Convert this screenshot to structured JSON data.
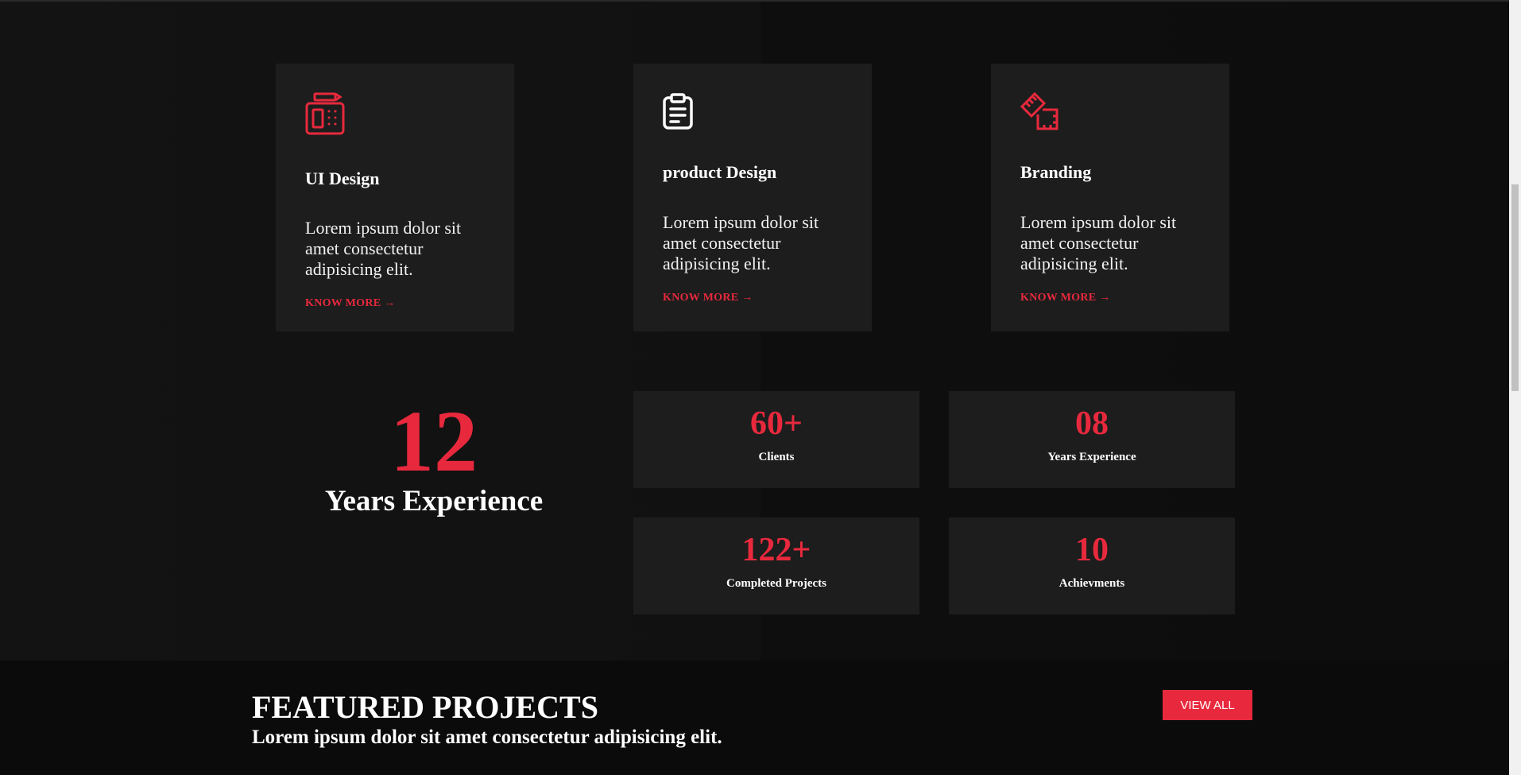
{
  "services": [
    {
      "icon": "fax-machine-icon",
      "title": "UI Design",
      "text": "Lorem ipsum dolor sit amet consectetur adipisicing elit.",
      "link": "KNOW MORE →"
    },
    {
      "icon": "clipboard-icon",
      "title": "product Design",
      "text": "Lorem ipsum dolor sit amet consectetur adipisicing elit.",
      "link": "KNOW MORE →"
    },
    {
      "icon": "ruler-pencil-icon",
      "title": "Branding",
      "text": "Lorem ipsum dolor sit amet consectetur adipisicing elit.",
      "link": "KNOW MORE →"
    }
  ],
  "experience": {
    "number": "12",
    "label": "Years Experience"
  },
  "stats": [
    {
      "number": "60+",
      "label": "Clients"
    },
    {
      "number": "08",
      "label": "Years Experience"
    },
    {
      "number": "122+",
      "label": "Completed Projects"
    },
    {
      "number": "10",
      "label": "Achievments"
    }
  ],
  "featured": {
    "title": "FEATURED PROJECTS",
    "subtitle": "Lorem ipsum dolor sit amet consectetur adipisicing elit.",
    "button": "VIEW ALL"
  },
  "colors": {
    "accent": "#e8293d",
    "card": "#1d1d1d",
    "background": "#0f0f0f"
  }
}
